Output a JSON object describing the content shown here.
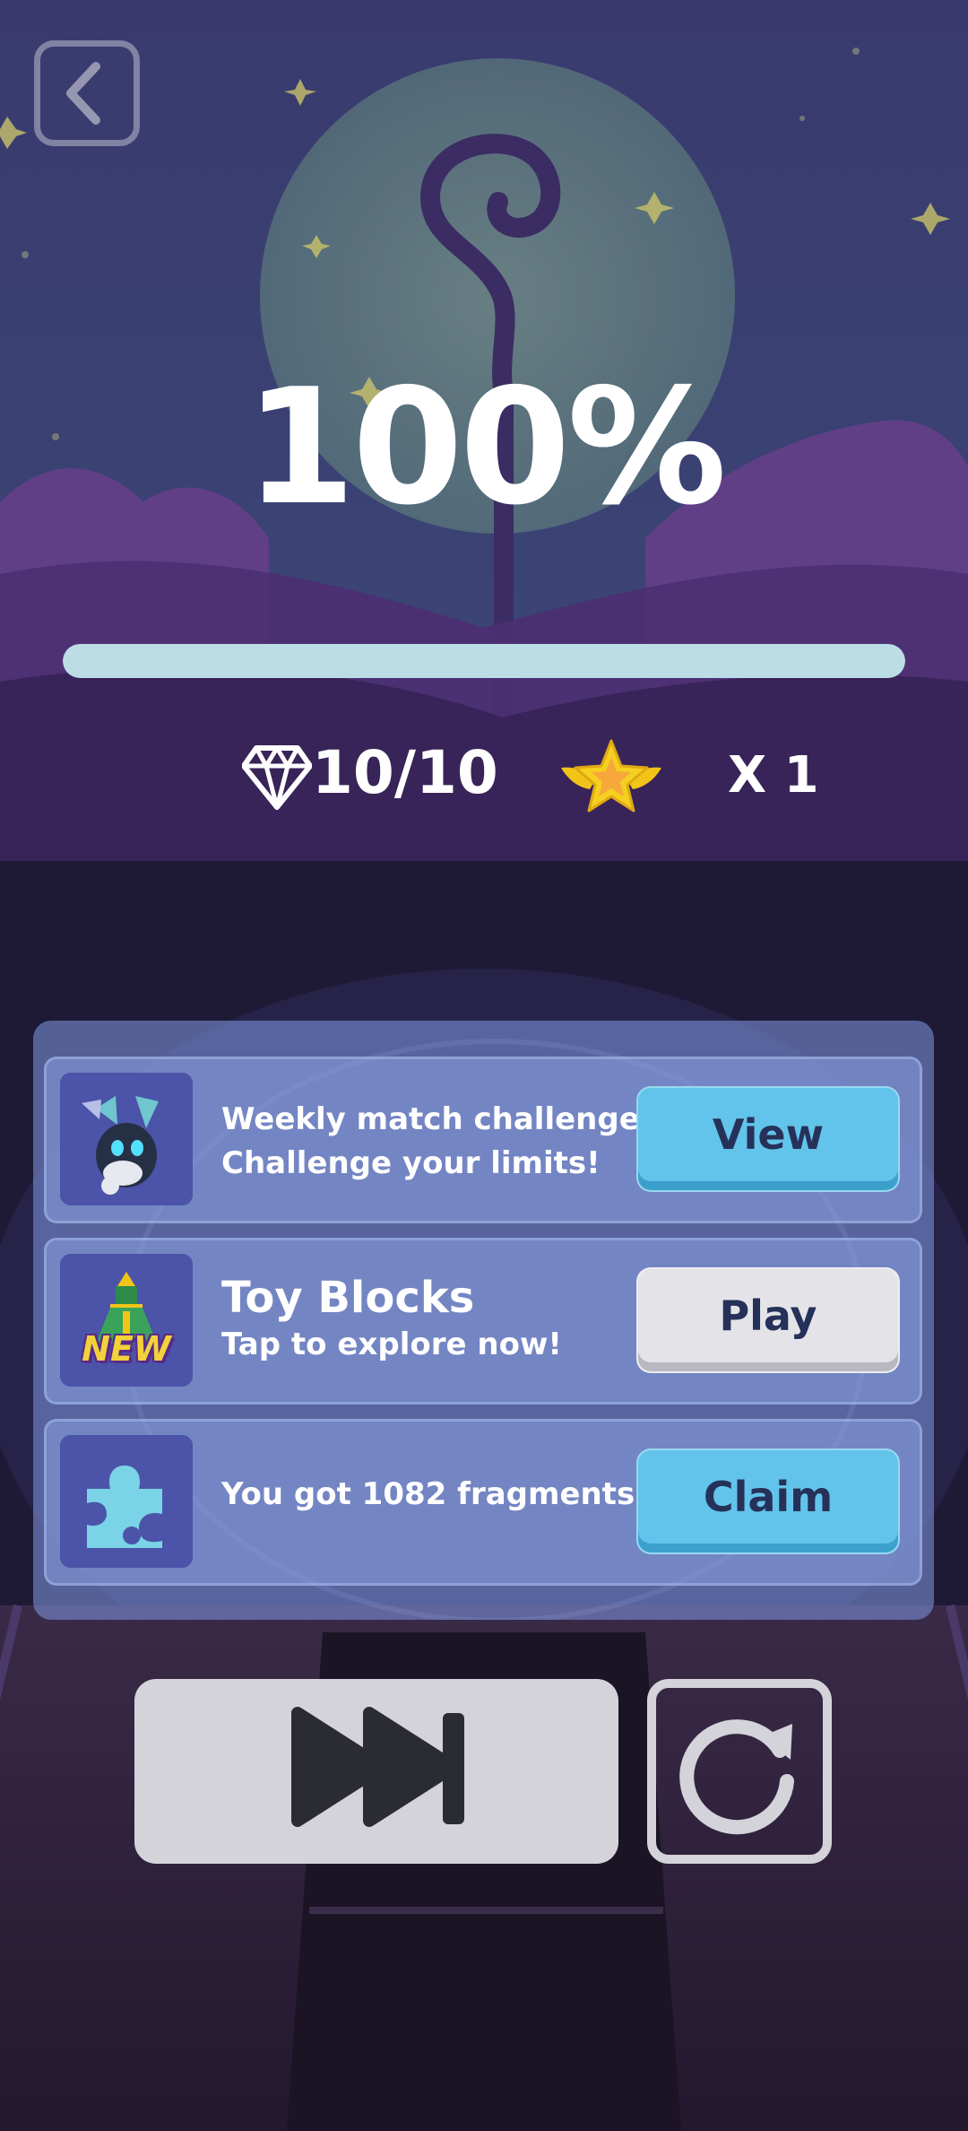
{
  "header": {
    "back_icon": "chevron-left-icon"
  },
  "result": {
    "percent_label": "100%",
    "progress_fraction": 1.0
  },
  "stats": {
    "gem_icon": "diamond-icon",
    "gem_count": "10/10",
    "star_icon": "winged-star-icon",
    "star_count": "X 1"
  },
  "panel": {
    "rows": [
      {
        "icon": "robot-bunny-icon",
        "line1": "Weekly match challenge",
        "line2": "Challenge your limits!",
        "button_label": "View",
        "button_style": "blue"
      },
      {
        "icon": "toy-rocket-new-icon",
        "badge": "NEW",
        "title": "Toy Blocks",
        "subtitle": "Tap to explore now!",
        "button_label": "Play",
        "button_style": "grey"
      },
      {
        "icon": "puzzle-piece-icon",
        "line1": "You got 1082 fragments!",
        "button_label": "Claim",
        "button_style": "blue"
      }
    ]
  },
  "controls": {
    "skip_icon": "skip-forward-icon",
    "replay_icon": "replay-icon"
  },
  "colors": {
    "progress_fill": "#bcdde6",
    "button_blue": "#62c4ea",
    "button_grey": "#e4e4e8",
    "button_text": "#26315a",
    "panel": "#7890d2"
  }
}
